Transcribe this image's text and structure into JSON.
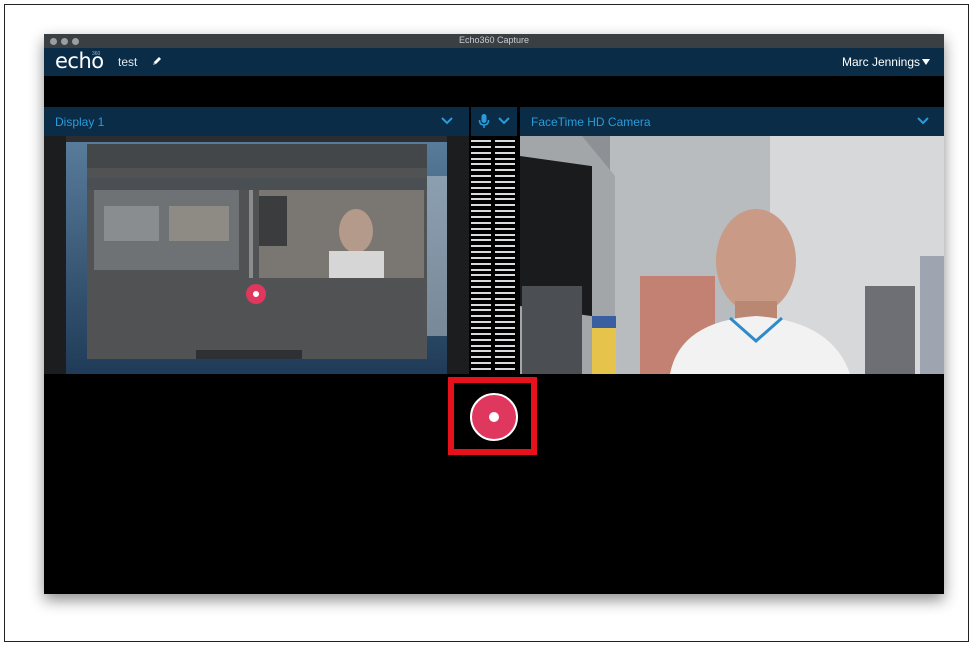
{
  "window": {
    "title": "Echo360 Capture"
  },
  "appbar": {
    "logo": "echo",
    "logo_sup": "360",
    "capture_name": "test",
    "user_name": "Marc Jennings"
  },
  "sources": {
    "display": {
      "label": "Display 1"
    },
    "camera": {
      "label": "FaceTime HD Camera"
    }
  },
  "icons": {
    "edit": "pencil-icon",
    "microphone": "microphone-icon",
    "dropdown": "chevron-down-icon",
    "record": "record-icon"
  },
  "colors": {
    "appbar": "#0a2c47",
    "accent_blue": "#2a9bd9",
    "record": "#e0375f",
    "highlight": "#e8101a"
  }
}
